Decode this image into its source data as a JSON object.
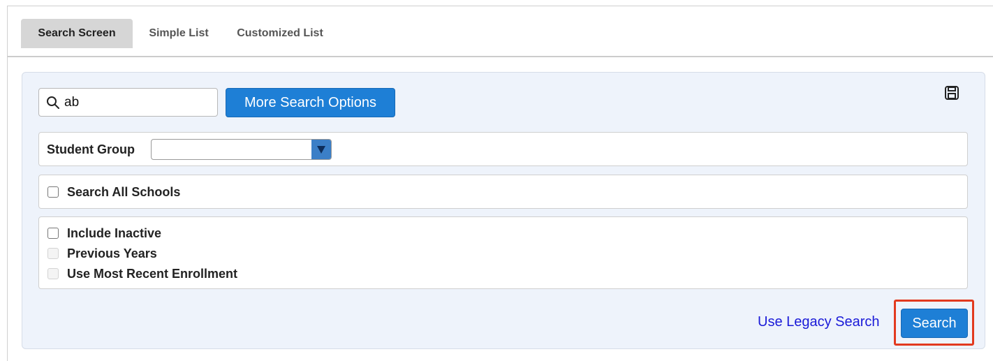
{
  "tabs": [
    {
      "label": "Search Screen",
      "active": true
    },
    {
      "label": "Simple List",
      "active": false
    },
    {
      "label": "Customized List",
      "active": false
    }
  ],
  "search": {
    "value": "ab",
    "more_options_label": "More Search Options"
  },
  "icons": {
    "search": "magnifier-icon",
    "save": "floppy-disk-icon",
    "dropdown": "triangle-down-icon"
  },
  "student_group": {
    "label": "Student Group",
    "selected": ""
  },
  "search_all_schools": {
    "label": "Search All Schools",
    "checked": false
  },
  "options": {
    "include_inactive": "Include Inactive",
    "previous_years": "Previous Years",
    "use_most_recent_enrollment": "Use Most Recent Enrollment"
  },
  "footer": {
    "legacy_link": "Use Legacy Search",
    "search_button": "Search"
  },
  "colors": {
    "accent_blue": "#1e7fd6",
    "highlight_red": "#e23a1f",
    "link_blue": "#1a1ad8",
    "panel_bg": "#eef3fb"
  }
}
